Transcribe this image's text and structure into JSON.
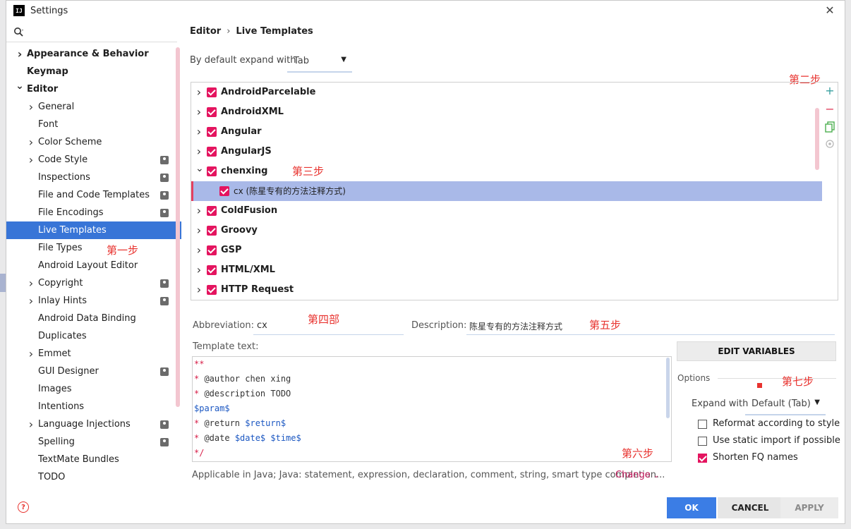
{
  "window": {
    "title": "Settings",
    "app_icon_text": "IJ"
  },
  "search": {
    "placeholder": ""
  },
  "tree": [
    {
      "label": "Appearance & Behavior",
      "level": 0,
      "chevron": "right",
      "bold": true,
      "project": false,
      "selected": false
    },
    {
      "label": "Keymap",
      "level": 0,
      "chevron": "",
      "bold": true,
      "project": false,
      "selected": false
    },
    {
      "label": "Editor",
      "level": 0,
      "chevron": "down",
      "bold": true,
      "project": false,
      "selected": false
    },
    {
      "label": "General",
      "level": 1,
      "chevron": "right",
      "bold": false,
      "project": false,
      "selected": false
    },
    {
      "label": "Font",
      "level": 1,
      "chevron": "",
      "bold": false,
      "project": false,
      "selected": false
    },
    {
      "label": "Color Scheme",
      "level": 1,
      "chevron": "right",
      "bold": false,
      "project": false,
      "selected": false
    },
    {
      "label": "Code Style",
      "level": 1,
      "chevron": "right",
      "bold": false,
      "project": true,
      "selected": false
    },
    {
      "label": "Inspections",
      "level": 1,
      "chevron": "",
      "bold": false,
      "project": true,
      "selected": false
    },
    {
      "label": "File and Code Templates",
      "level": 1,
      "chevron": "",
      "bold": false,
      "project": true,
      "selected": false
    },
    {
      "label": "File Encodings",
      "level": 1,
      "chevron": "",
      "bold": false,
      "project": true,
      "selected": false
    },
    {
      "label": "Live Templates",
      "level": 1,
      "chevron": "",
      "bold": false,
      "project": false,
      "selected": true
    },
    {
      "label": "File Types",
      "level": 1,
      "chevron": "",
      "bold": false,
      "project": false,
      "selected": false
    },
    {
      "label": "Android Layout Editor",
      "level": 1,
      "chevron": "",
      "bold": false,
      "project": false,
      "selected": false
    },
    {
      "label": "Copyright",
      "level": 1,
      "chevron": "right",
      "bold": false,
      "project": true,
      "selected": false
    },
    {
      "label": "Inlay Hints",
      "level": 1,
      "chevron": "right",
      "bold": false,
      "project": true,
      "selected": false
    },
    {
      "label": "Android Data Binding",
      "level": 1,
      "chevron": "",
      "bold": false,
      "project": false,
      "selected": false
    },
    {
      "label": "Duplicates",
      "level": 1,
      "chevron": "",
      "bold": false,
      "project": false,
      "selected": false
    },
    {
      "label": "Emmet",
      "level": 1,
      "chevron": "right",
      "bold": false,
      "project": false,
      "selected": false
    },
    {
      "label": "GUI Designer",
      "level": 1,
      "chevron": "",
      "bold": false,
      "project": true,
      "selected": false
    },
    {
      "label": "Images",
      "level": 1,
      "chevron": "",
      "bold": false,
      "project": false,
      "selected": false
    },
    {
      "label": "Intentions",
      "level": 1,
      "chevron": "",
      "bold": false,
      "project": false,
      "selected": false
    },
    {
      "label": "Language Injections",
      "level": 1,
      "chevron": "right",
      "bold": false,
      "project": true,
      "selected": false
    },
    {
      "label": "Spelling",
      "level": 1,
      "chevron": "",
      "bold": false,
      "project": true,
      "selected": false
    },
    {
      "label": "TextMate Bundles",
      "level": 1,
      "chevron": "",
      "bold": false,
      "project": false,
      "selected": false
    },
    {
      "label": "TODO",
      "level": 1,
      "chevron": "",
      "bold": false,
      "project": false,
      "selected": false
    }
  ],
  "annotations": {
    "step1": "第一步",
    "step2": "第二步",
    "step3": "第三步",
    "step4": "第四部",
    "step5": "第五步",
    "step6": "第六步",
    "step7": "第七步"
  },
  "breadcrumb": {
    "parent": "Editor",
    "separator": "›",
    "current": "Live Templates"
  },
  "expand_default": {
    "label": "By default expand with",
    "value": "Tab"
  },
  "template_groups": [
    {
      "label": "AndroidParcelable",
      "expanded": false,
      "child": false,
      "selected": false
    },
    {
      "label": "AndroidXML",
      "expanded": false,
      "child": false,
      "selected": false
    },
    {
      "label": "Angular",
      "expanded": false,
      "child": false,
      "selected": false
    },
    {
      "label": "AngularJS",
      "expanded": false,
      "child": false,
      "selected": false
    },
    {
      "label": "chenxing",
      "expanded": true,
      "child": false,
      "selected": false
    },
    {
      "label": "cx (陈星专有的方法注释方式)",
      "expanded": false,
      "child": true,
      "selected": true
    },
    {
      "label": "ColdFusion",
      "expanded": false,
      "child": false,
      "selected": false
    },
    {
      "label": "Groovy",
      "expanded": false,
      "child": false,
      "selected": false
    },
    {
      "label": "GSP",
      "expanded": false,
      "child": false,
      "selected": false
    },
    {
      "label": "HTML/XML",
      "expanded": false,
      "child": false,
      "selected": false
    },
    {
      "label": "HTTP Request",
      "expanded": false,
      "child": false,
      "selected": false
    }
  ],
  "tools": {
    "add": "+",
    "remove": "−"
  },
  "abbreviation": {
    "label": "Abbreviation:",
    "value": "cx"
  },
  "description": {
    "label": "Description:",
    "value": "陈星专有的方法注释方式"
  },
  "template_text": {
    "label": "Template text:",
    "lines": [
      [
        {
          "t": "**",
          "c": "red"
        }
      ],
      [
        {
          "t": "* ",
          "c": "red"
        },
        {
          "t": "@author chen xing",
          "c": ""
        }
      ],
      [
        {
          "t": "* ",
          "c": "red"
        },
        {
          "t": "@description TODO",
          "c": ""
        }
      ],
      [
        {
          "t": "$param$",
          "c": "blue"
        }
      ],
      [
        {
          "t": "* ",
          "c": "red"
        },
        {
          "t": "@return ",
          "c": ""
        },
        {
          "t": "$return$",
          "c": "blue"
        }
      ],
      [
        {
          "t": "* ",
          "c": "red"
        },
        {
          "t": "@date ",
          "c": ""
        },
        {
          "t": "$date$ $time$",
          "c": "blue"
        }
      ],
      [
        {
          "t": "*/",
          "c": "red"
        }
      ]
    ]
  },
  "edit_variables": "EDIT VARIABLES",
  "options": {
    "label": "Options",
    "expand_label": "Expand with",
    "expand_value": "Default (Tab)",
    "checkboxes": [
      {
        "label": "Reformat according to style",
        "checked": false
      },
      {
        "label": "Use static import if possible",
        "checked": false
      },
      {
        "label": "Shorten FQ names",
        "checked": true
      }
    ]
  },
  "applicable": {
    "text": "Applicable in Java; Java: statement, expression, declaration, comment, string, smart type completion...",
    "link": "Change"
  },
  "buttons": {
    "ok": "OK",
    "cancel": "CANCEL",
    "apply": "APPLY"
  },
  "colors": {
    "accent": "#3875d7",
    "checkbox": "#e4145f",
    "annotation": "#e8332f"
  }
}
